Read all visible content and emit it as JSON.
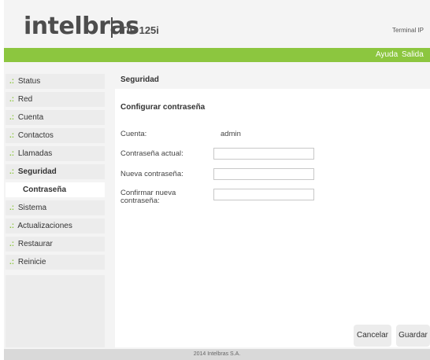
{
  "header": {
    "logo_text": "intelbras",
    "model": "TIP 125i",
    "terminal_label": "Terminal IP"
  },
  "topbar": {
    "help_label": "Ayuda",
    "logout_label": "Salida",
    "bar_color": "#8cc63f"
  },
  "sidebar": {
    "items": [
      {
        "label": "Status"
      },
      {
        "label": "Red"
      },
      {
        "label": "Cuenta"
      },
      {
        "label": "Contactos"
      },
      {
        "label": "Llamadas"
      },
      {
        "label": "Seguridad"
      },
      {
        "label": "Contraseña"
      },
      {
        "label": "Sistema"
      },
      {
        "label": "Actualizaciones"
      },
      {
        "label": "Restaurar"
      },
      {
        "label": "Reinicie"
      }
    ],
    "bullet": ".:"
  },
  "main": {
    "section_header": "Seguridad",
    "form_title": "Configurar contraseña",
    "fields": {
      "account_label": "Cuenta:",
      "account_value": "admin",
      "current_label": "Contraseña actual:",
      "current_value": "",
      "new_label": "Nueva contraseña:",
      "new_value": "",
      "confirm_label": "Confirmar nueva contraseña:",
      "confirm_value": ""
    },
    "cancel_label": "Cancelar",
    "save_label": "Guardar"
  },
  "footer": {
    "copyright": "2014 Intelbras S.A."
  }
}
